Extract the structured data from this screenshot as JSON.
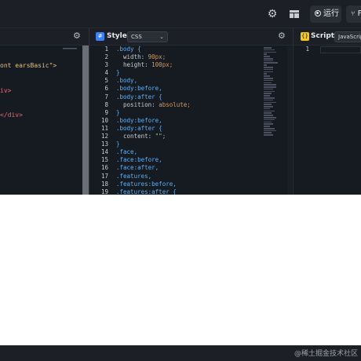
{
  "topbar": {
    "settings_icon": "gear-icon",
    "layout_icon": "layout-grid-icon",
    "run_label": "运行",
    "fork_label": "F"
  },
  "html_panel": {
    "code_lines": [
      "ont earsBasic\">",
      "iv>",
      "</div>"
    ]
  },
  "css_panel": {
    "title": "Style",
    "badge": "#",
    "language": "CSS",
    "line_numbers": [
      "1",
      "2",
      "3",
      "4",
      "5",
      "6",
      "7",
      "8",
      "9",
      "10",
      "11",
      "12",
      "13",
      "14",
      "15",
      "16",
      "17",
      "18",
      "19"
    ],
    "code_lines": [
      ".body {",
      "  width: 90px;",
      "  height: 100px;",
      "}",
      ".body,",
      ".body:before,",
      ".body:after {",
      "  position: absolute;",
      "}",
      ".body:before,",
      ".body:after {",
      "  content: \"\";",
      "}",
      ".face,",
      ".face:before,",
      ".face:after,",
      ".features,",
      ".features:before,",
      ".features:after {"
    ]
  },
  "js_panel": {
    "title": "Script",
    "badge": "{}",
    "language": "JavaScript",
    "line_numbers": [
      "1"
    ]
  },
  "footer": {
    "watermark": "@稀土掘金技术社区"
  },
  "colors": {
    "topbar_bg": "#1c1f26",
    "editor_bg": "#161a21",
    "css_badge": "#3b82f6",
    "js_badge": "#f5c518",
    "selector": "#61afef",
    "value": "#d19a66"
  }
}
